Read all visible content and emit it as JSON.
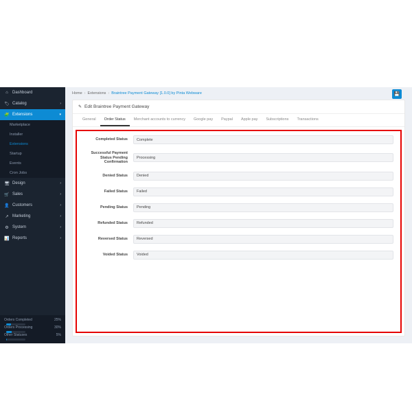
{
  "breadcrumb": {
    "home": "Home",
    "ext": "Extensions",
    "page": "Braintree Payment Gateway [1.0.0] by Pinta Webware"
  },
  "panel": {
    "title": "Edit Braintree Payment Gateway"
  },
  "tabs": [
    "General",
    "Order Status",
    "Merchant accounts to currency",
    "Google pay",
    "Paypal",
    "Apple pay",
    "Subscriptions",
    "Transactions"
  ],
  "sidebar": {
    "items": [
      {
        "label": "Dashboard",
        "icon": "⌂"
      },
      {
        "label": "Catalog",
        "icon": "🏷"
      },
      {
        "label": "Extensions",
        "icon": "🧩",
        "sub": [
          "Marketplace",
          "Installer",
          "Extensions",
          "Startup",
          "Events",
          "Cron Jobs"
        ]
      },
      {
        "label": "Design",
        "icon": "🖥"
      },
      {
        "label": "Sales",
        "icon": "🛒"
      },
      {
        "label": "Customers",
        "icon": "👤"
      },
      {
        "label": "Marketing",
        "icon": "↗"
      },
      {
        "label": "System",
        "icon": "⚙"
      },
      {
        "label": "Reports",
        "icon": "📊"
      }
    ],
    "stats": [
      {
        "label": "Orders Completed",
        "pct": 25
      },
      {
        "label": "Orders Processing",
        "pct": 30
      },
      {
        "label": "Other Statuses",
        "pct": 5
      }
    ]
  },
  "form": {
    "rows": [
      {
        "label": "Completed Status",
        "value": "Complete"
      },
      {
        "label": "Successful Payment Status Pending Confirmation",
        "value": "Processing"
      },
      {
        "label": "Denied Status",
        "value": "Denied"
      },
      {
        "label": "Failed Status",
        "value": "Failed"
      },
      {
        "label": "Pending Status",
        "value": "Pending"
      },
      {
        "label": "Refunded Status",
        "value": "Refunded"
      },
      {
        "label": "Reversed Status",
        "value": "Reversed"
      },
      {
        "label": "Voided Status",
        "value": "Voided"
      }
    ]
  }
}
